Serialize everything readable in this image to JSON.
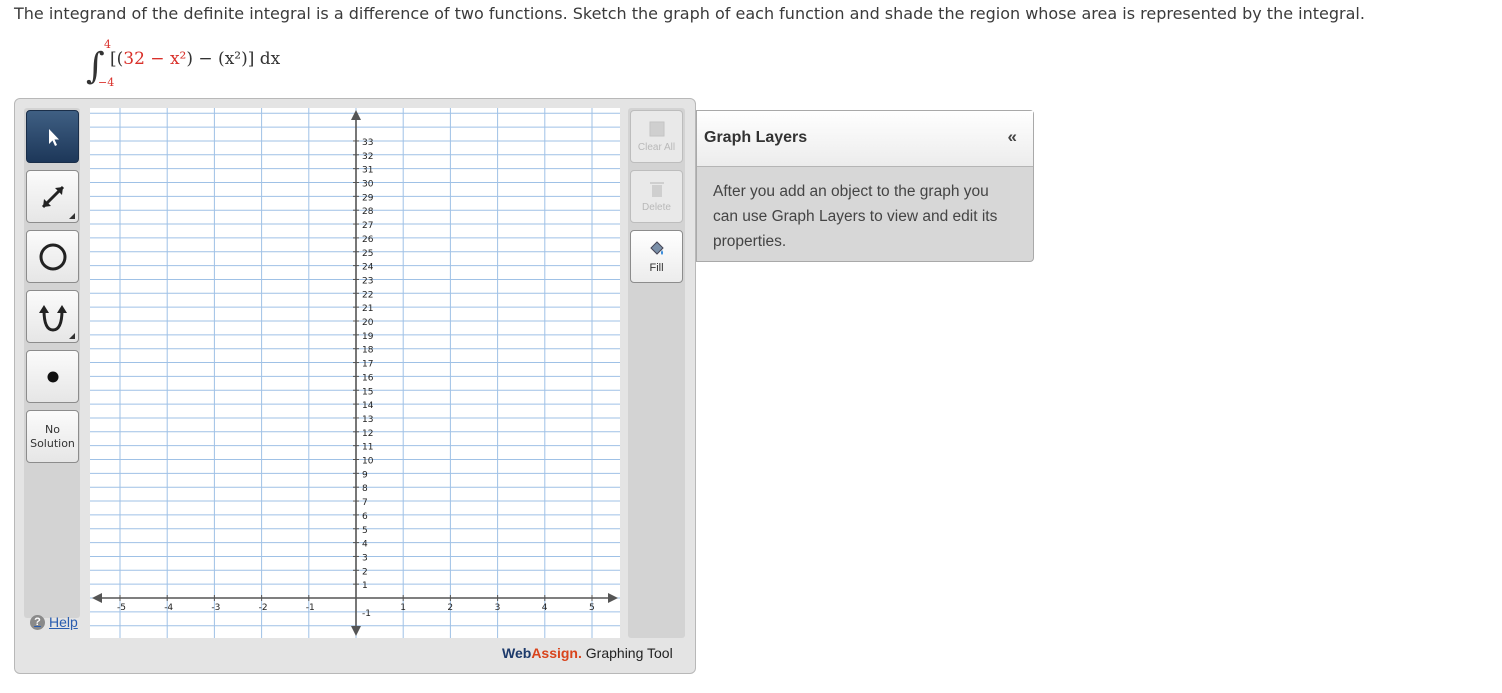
{
  "prompt": "The integrand of the definite integral is a difference of two functions. Sketch the graph of each function and shade the region whose area is represented by the integral.",
  "integral": {
    "lower": "−4",
    "upper": "4",
    "open": "[(",
    "f_part": "32 − x²",
    "middle": ") − (",
    "g_part": "x²",
    "close": ")] dx"
  },
  "toolbar": {
    "tools": [
      {
        "name": "select-tool",
        "icon": "arrow-pointer-icon",
        "active": true
      },
      {
        "name": "line-tool",
        "icon": "line-arrow-icon",
        "active": false
      },
      {
        "name": "circle-tool",
        "icon": "circle-icon",
        "active": false
      },
      {
        "name": "parabola-tool",
        "icon": "parabola-icon",
        "active": false
      },
      {
        "name": "point-tool",
        "icon": "point-icon",
        "active": false
      }
    ],
    "no_solution_line1": "No",
    "no_solution_line2": "Solution",
    "help": "Help"
  },
  "graph": {
    "x_ticks": [
      "-5",
      "-4",
      "-3",
      "-2",
      "-1",
      "1",
      "2",
      "3",
      "4",
      "5"
    ],
    "y_ticks": [
      "1",
      "2",
      "3",
      "4",
      "5",
      "6",
      "7",
      "8",
      "9",
      "10",
      "11",
      "12",
      "13",
      "14",
      "15",
      "16",
      "17",
      "18",
      "19",
      "20",
      "21",
      "22",
      "23",
      "24",
      "25",
      "26",
      "27",
      "28",
      "29",
      "30",
      "31",
      "32",
      "33"
    ],
    "y_neg_tick": "-1",
    "grid_color": "#9fc1e6"
  },
  "actions": {
    "clear_all": "Clear All",
    "delete": "Delete",
    "fill": "Fill"
  },
  "brand": {
    "part1": "Web",
    "part2": "Assign.",
    "part3": " Graphing Tool"
  },
  "layers": {
    "title": "Graph Layers",
    "collapse": "«",
    "message": "After you add an object to the graph you can use Graph Layers to view and edit its properties."
  }
}
